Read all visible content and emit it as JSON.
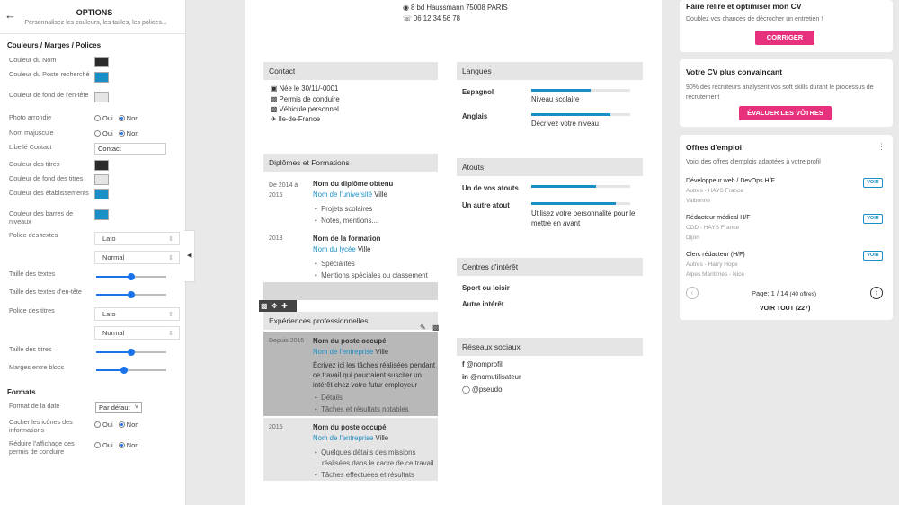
{
  "options": {
    "back_icon": "arrow-left-icon",
    "title": "OPTIONS",
    "subtitle": "Personnalisez les couleurs, les tailles, les polices...",
    "section_colors": "Couleurs / Marges / Polices",
    "color_rows": [
      {
        "label": "Couleur du Nom",
        "color": "#2b2b2b"
      },
      {
        "label": "Couleur du Poste recherché",
        "color": "#1a8fc6"
      },
      {
        "label": "Couleur de fond de l'en-tête",
        "color": "#e5e5e5"
      }
    ],
    "photo_label": "Photo arrondie",
    "name_upper_label": "Nom majuscule",
    "oui": "Oui",
    "non": "Non",
    "libelle_label": "Libellé Contact",
    "libelle_value": "Contact",
    "color_rows2": [
      {
        "label": "Couleur des titres",
        "color": "#2b2b2b"
      },
      {
        "label": "Couleur de fond des titres",
        "color": "#e5e5e5"
      },
      {
        "label": "Couleur des établissements",
        "color": "#1a8fc6"
      },
      {
        "label": "Couleur des barres de niveaux",
        "color": "#1a8fc6"
      }
    ],
    "font_texts_label": "Police des textes",
    "font_texts_value": "Lato",
    "font_texts_weight": "Normal",
    "size_texts_label": "Taille des textes",
    "size_texts_level": 0.5,
    "size_header_label": "Taille des textes d'en-tête",
    "size_header_level": 0.5,
    "font_titles_label": "Police des titres",
    "font_titles_value": "Lato",
    "font_titles_weight": "Normal",
    "size_titles_label": "Taille des titres",
    "size_titles_level": 0.5,
    "margins_label": "Marges entre blocs",
    "margins_level": 0.4,
    "section_formats": "Formats",
    "date_format_label": "Format de la date",
    "date_format_value": "Par défaut",
    "hide_icons_label": "Cacher les icônes des informations",
    "hide_license_label": "Réduire l'affichage des permis de conduire",
    "collapse_icon": "caret-left-icon"
  },
  "cv": {
    "address": "8 bd Haussmann 75008 PARIS",
    "phone": "06 12 34 56 78",
    "contact_title": "Contact",
    "contact_items": [
      {
        "icon": "calendar-icon",
        "text": "Née le 30/11/-0001"
      },
      {
        "icon": "car-icon",
        "text": "Permis de conduire"
      },
      {
        "icon": "car-icon",
        "text": "Véhicule personnel"
      },
      {
        "icon": "plane-icon",
        "text": "Ile-de-France"
      }
    ],
    "diplomas_title": "Diplômes et Formations",
    "diplomas": [
      {
        "date": "De 2014 à 2015",
        "name": "Nom du diplôme obtenu",
        "school": "Nom de l'université",
        "city": "Ville",
        "bullets": [
          "Projets scolaires",
          "Notes, mentions..."
        ]
      },
      {
        "date": "2013",
        "name": "Nom de la formation",
        "school": "Nom du lycée",
        "city": "Ville",
        "bullets": [
          "Spécialités",
          "Mentions spéciales ou classement"
        ]
      }
    ],
    "experience_title": "Expériences professionnelles",
    "experiences": [
      {
        "date": "Depuis 2015",
        "name": "Nom du poste occupé",
        "company": "Nom de l'entreprise",
        "city": "Ville",
        "desc": [
          "Écrivez ici les tâches réalisées pendant",
          "ce travail qui pourraient susciter un",
          "intérêt chez votre futur employeur"
        ],
        "bullets": [
          "Détails",
          "Tâches et résultats notables"
        ]
      },
      {
        "date": "2015",
        "name": "Nom du poste occupé",
        "company": "Nom de l'entreprise",
        "city": "Ville",
        "desc": [],
        "bullets": [
          "Quelques détails des missions",
          "réalisées dans le cadre de ce travail",
          "Tâches effectuées et résultats"
        ]
      }
    ],
    "languages_title": "Langues",
    "languages": [
      {
        "name": "Espagnol",
        "level": 0.6,
        "text": "Niveau scolaire"
      },
      {
        "name": "Anglais",
        "level": 0.8,
        "text": "Décrivez votre niveau"
      }
    ],
    "atouts_title": "Atouts",
    "atouts": [
      {
        "name": "Un de vos atouts",
        "level": 0.65,
        "text": ""
      },
      {
        "name": "Un autre atout",
        "level": 0.85,
        "text": "Utilisez votre personnalité pour le mettre en avant"
      }
    ],
    "interests_title": "Centres d'intérêt",
    "interests": [
      "Sport ou loisir",
      "Autre intérêt"
    ],
    "social_title": "Réseaux sociaux",
    "social": [
      {
        "icon": "facebook-icon",
        "text": "@nomprofil"
      },
      {
        "icon": "linkedin-icon",
        "text": "@nomutilisateur"
      },
      {
        "icon": "instagram-icon",
        "text": "@pseudo"
      }
    ]
  },
  "right": {
    "card1_title": "Faire relire et optimiser mon CV",
    "card1_text": "Doublez vos chances de décrocher un entretien !",
    "card1_button": "CORRIGER",
    "card2_title": "Votre CV plus convaincant",
    "card2_text": "90% des recruteurs analysent vos soft skills durant le processus de recrutement",
    "card2_button": "ÉVALUER LES VÔTRES",
    "jobs_title": "Offres d'emploi",
    "jobs_subtitle": "Voici des offres d'emplois adaptées à votre profil",
    "jobs": [
      {
        "title": "Développeur web / DevOps H/F",
        "company": "Autres - HAYS France",
        "city": "Valbonne"
      },
      {
        "title": "Rédacteur médical H/F",
        "company": "CDD - HAYS France",
        "city": "Dijon"
      },
      {
        "title": "Clerc rédacteur (H/F)",
        "company": "Autres - Harry Hope",
        "city": "Alpes Maritimes - Nice"
      }
    ],
    "voir": "VOIR",
    "page_label": "Page: 1 / 14",
    "page_count": "(40 offres)",
    "voir_tout": "VOIR TOUT (227)"
  },
  "colors": {
    "accent": "#1a8fc6",
    "pink": "#e8317d"
  }
}
